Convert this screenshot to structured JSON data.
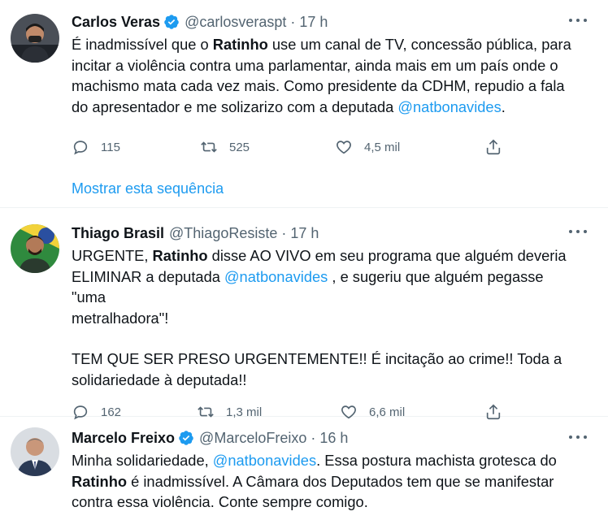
{
  "tweets": [
    {
      "name": "Carlos Veras",
      "verified": true,
      "handle": "@carlosveraspt",
      "time": "17 h",
      "body": [
        [
          {
            "t": "É inadmissível que o "
          },
          {
            "t": "Ratinho",
            "b": true
          },
          {
            "t": " use um canal de TV, concessão pública, para"
          }
        ],
        [
          {
            "t": "incitar a violência contra uma parlamentar, ainda mais em um país onde o"
          }
        ],
        [
          {
            "t": "machismo mata cada vez mais. Como presidente da CDHM, repudio a fala"
          }
        ],
        [
          {
            "t": "do apresentador e me solizarizo com a deputada "
          },
          {
            "t": "@natbonavides",
            "m": true
          },
          {
            "t": "."
          }
        ]
      ],
      "replies": "115",
      "retweets": "525",
      "likes": "4,5 mil",
      "show_thread": "Mostrar esta sequência"
    },
    {
      "name": "Thiago Brasil",
      "verified": false,
      "handle": "@ThiagoResiste",
      "time": "17 h",
      "body": [
        [
          {
            "t": "URGENTE, "
          },
          {
            "t": "Ratinho",
            "b": true
          },
          {
            "t": " disse AO VIVO em seu programa que alguém deveria"
          }
        ],
        [
          {
            "t": "ELIMINAR a deputada "
          },
          {
            "t": "@natbonavides",
            "m": true
          },
          {
            "t": " , e sugeriu que alguém pegasse \"uma"
          }
        ],
        [
          {
            "t": "metralhadora\"!"
          }
        ],
        [],
        [
          {
            "t": "TEM QUE SER PRESO URGENTEMENTE!! É incitação ao crime!! Toda a"
          }
        ],
        [
          {
            "t": "solidariedade à deputada!!"
          }
        ]
      ],
      "replies": "162",
      "retweets": "1,3 mil",
      "likes": "6,6 mil"
    },
    {
      "name": "Marcelo Freixo",
      "verified": true,
      "handle": "@MarceloFreixo",
      "time": "16 h",
      "body": [
        [
          {
            "t": "Minha solidariedade, "
          },
          {
            "t": "@natbonavides",
            "m": true
          },
          {
            "t": ". Essa postura machista grotesca do"
          }
        ],
        [
          {
            "t": "Ratinho",
            "b": true
          },
          {
            "t": " é inadmissível. A Câmara dos Deputados tem que se manifestar"
          }
        ],
        [
          {
            "t": "contra essa violência. Conte sempre comigo."
          }
        ]
      ]
    }
  ],
  "colors": {
    "accent": "#1d9bf0",
    "muted": "#536471",
    "text": "#0f1419"
  },
  "icons": [
    "verified-badge-icon",
    "more-icon",
    "reply-icon",
    "retweet-icon",
    "like-icon",
    "share-icon"
  ]
}
